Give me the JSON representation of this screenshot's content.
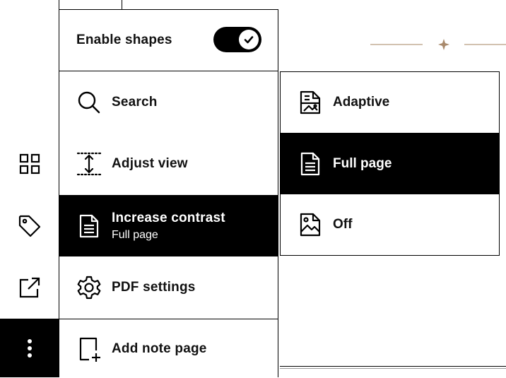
{
  "menu": {
    "toggle": {
      "label": "Enable shapes",
      "checked": true
    },
    "items": [
      {
        "label": "Search",
        "icon": "search-icon"
      },
      {
        "label": "Adjust view",
        "icon": "adjust-view-icon"
      },
      {
        "label": "Increase contrast",
        "sublabel": "Full page",
        "icon": "document-icon",
        "active": true
      },
      {
        "label": "PDF settings",
        "icon": "gear-icon"
      },
      {
        "label": "Add note page",
        "icon": "add-page-icon"
      }
    ]
  },
  "submenu": {
    "items": [
      {
        "label": "Adaptive",
        "icon": "adaptive-icon"
      },
      {
        "label": "Full page",
        "icon": "document-icon",
        "selected": true
      },
      {
        "label": "Off",
        "icon": "image-off-icon"
      }
    ]
  },
  "toolbar": {
    "buttons": [
      "grid-icon",
      "tag-icon",
      "export-icon",
      "more-icon"
    ]
  },
  "colors": {
    "accent": "#000000",
    "decor": "#b89b7f"
  }
}
